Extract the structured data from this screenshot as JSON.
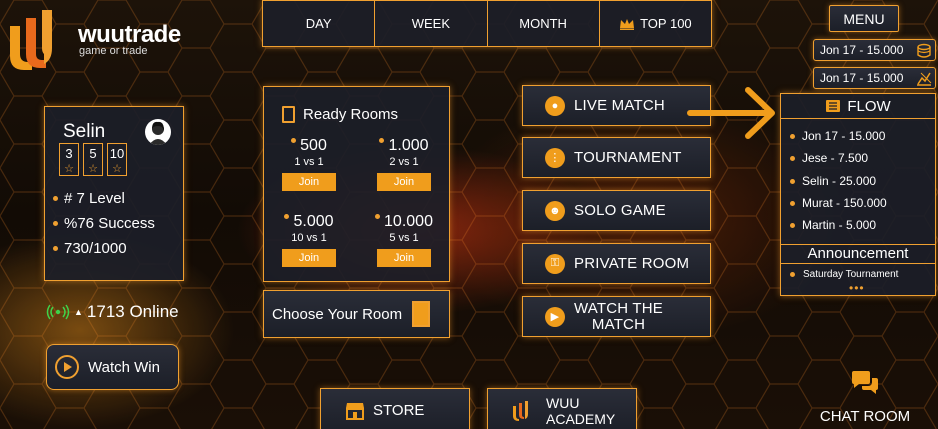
{
  "brand": {
    "name": "wuutrade",
    "tagline": "game or trade"
  },
  "top_tabs": [
    {
      "label": "DAY"
    },
    {
      "label": "WEEK"
    },
    {
      "label": "MONTH"
    },
    {
      "label": "TOP 100",
      "icon": "crown-icon"
    }
  ],
  "menu": {
    "label": "MENU"
  },
  "coins": [
    {
      "text": "Jon 17 - 15.000",
      "icon": "coins-icon"
    },
    {
      "text": "Jon 17 - 15.000",
      "icon": "chart-icon"
    }
  ],
  "profile": {
    "name": "Selin",
    "badges": [
      "3",
      "5",
      "10"
    ],
    "stats": [
      "# 7 Level",
      "%76 Success",
      "730/1000"
    ]
  },
  "online": {
    "text": "1713 Online"
  },
  "watch_win": {
    "label": "Watch Win"
  },
  "ready_rooms": {
    "title": "Ready Rooms",
    "rooms": [
      {
        "amount": "500",
        "mode": "1 vs 1",
        "join": "Join"
      },
      {
        "amount": "1.000",
        "mode": "2 vs 1",
        "join": "Join"
      },
      {
        "amount": "5.000",
        "mode": "10 vs 1",
        "join": "Join"
      },
      {
        "amount": "10.000",
        "mode": "5 vs 1",
        "join": "Join"
      }
    ]
  },
  "choose_room": {
    "label": "Choose Your Room"
  },
  "modes": [
    {
      "label": "LIVE MATCH"
    },
    {
      "label": "TOURNAMENT"
    },
    {
      "label": "SOLO GAME"
    },
    {
      "label": "PRIVATE ROOM"
    },
    {
      "label_line1": "WATCH THE",
      "label_line2": "MATCH"
    }
  ],
  "flow": {
    "title": "FLOW",
    "items": [
      "Jon 17 - 15.000",
      "Jese - 7.500",
      "Selin - 25.000",
      "Murat - 150.000",
      "Martin - 5.000"
    ],
    "announcement_title": "Announcement",
    "announcements": [
      "Saturday Tournament"
    ],
    "more": "•••"
  },
  "store": {
    "label": "STORE"
  },
  "academy": {
    "label_line1": "WUU",
    "label_line2": "ACADEMY"
  },
  "chat": {
    "label": "CHAT ROOM"
  },
  "colors": {
    "accent": "#f09d1c",
    "panel": "#1c1f28",
    "border": "#f0a030"
  }
}
